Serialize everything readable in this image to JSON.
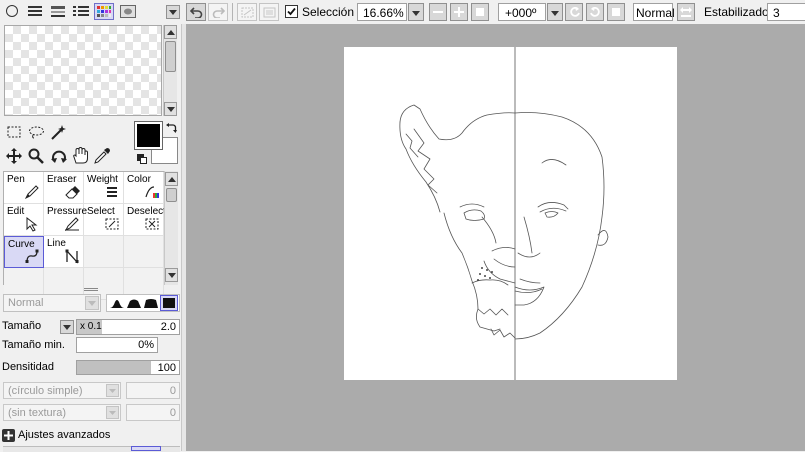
{
  "toolbar": {
    "selection_label": "Selección",
    "selection_checked": true,
    "zoom_value": "16.66%",
    "rotation_value": "+000º",
    "blend_mode": "Normal",
    "stabilizer_label": "Estabilizador",
    "stabilizer_value": "3"
  },
  "brush_tools": [
    {
      "label": "Pen",
      "icon": "pen-icon",
      "selected": false
    },
    {
      "label": "Eraser",
      "icon": "eraser-icon",
      "selected": false
    },
    {
      "label": "Weight",
      "icon": "weight-icon",
      "selected": false
    },
    {
      "label": "Color",
      "icon": "color-icon",
      "selected": false
    },
    {
      "label": "Edit",
      "icon": "edit-icon",
      "selected": false
    },
    {
      "label": "Pressure",
      "icon": "pressure-icon",
      "selected": false
    },
    {
      "label": "Select",
      "icon": "select-icon",
      "selected": false
    },
    {
      "label": "Deselect",
      "icon": "deselect-icon",
      "selected": false
    },
    {
      "label": "Curve",
      "icon": "curve-icon",
      "selected": true
    },
    {
      "label": "Line",
      "icon": "line-icon",
      "selected": false
    }
  ],
  "brush_settings": {
    "blend_mode_placeholder": "Normal",
    "size_label": "Tamaño",
    "size_multiplier": "x 0.1",
    "size_value": "2.0",
    "min_size_label": "Tamaño min.",
    "min_size_value": "0%",
    "density_label": "Densitidad",
    "density_value": "100",
    "density_level": 1.0,
    "shape_select": "(círculo simple)",
    "shape_value": "0",
    "texture_select": "(sin textura)",
    "texture_value": "0",
    "advanced_label": "Ajustes avanzados"
  },
  "colors": {
    "primary": "#000000",
    "secondary": "#ffffff",
    "canvas_bg": "#ababab",
    "accent": "#5b5bd6"
  }
}
